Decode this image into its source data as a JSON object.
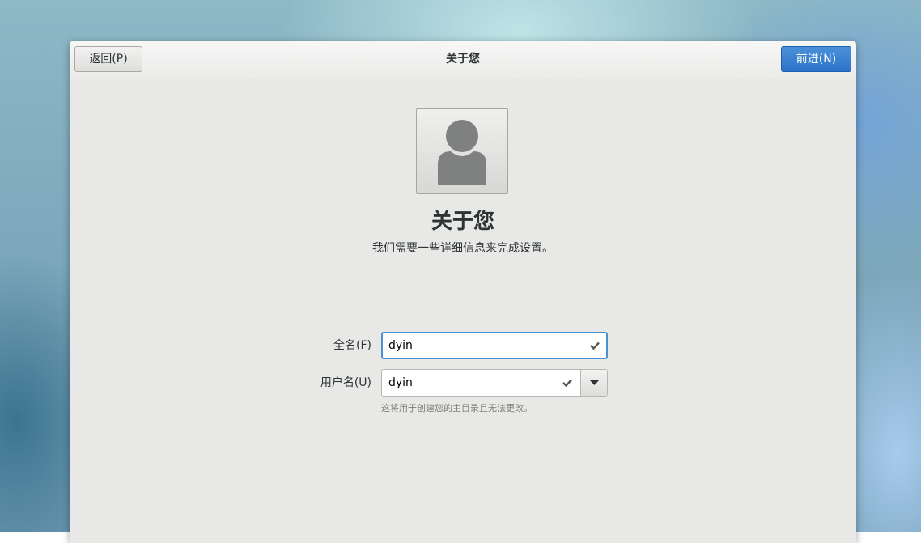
{
  "header": {
    "title": "关于您",
    "back_label": "返回(P)",
    "next_label": "前进(N)"
  },
  "avatar": {
    "icon": "user-avatar-icon"
  },
  "main": {
    "heading": "关于您",
    "subtitle": "我们需要一些详细信息来完成设置。"
  },
  "form": {
    "fullname": {
      "label": "全名(F)",
      "value": "dyin",
      "status_icon": "checkmark-icon"
    },
    "username": {
      "label": "用户名(U)",
      "value": "dyin",
      "status_icon": "checkmark-icon",
      "dropdown_icon": "chevron-down-icon"
    },
    "hint": "这将用于创建您的主目录且无法更改。"
  },
  "colors": {
    "accent": "#2d74c9",
    "window_bg": "#e8e8e7"
  }
}
